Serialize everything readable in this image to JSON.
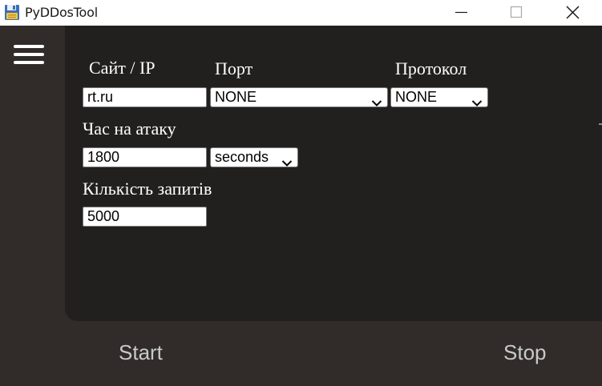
{
  "window": {
    "title": "PyDDosTool",
    "app_icon": "floppy-disk-icon",
    "controls": [
      "minimize-icon",
      "maximize-icon",
      "close-icon"
    ]
  },
  "sidebar": {
    "menu_icon": "hamburger-menu-icon"
  },
  "form": {
    "site_label": "Сайт / IP",
    "site_value": "rt.ru",
    "port_label": "Порт",
    "port_value": "NONE",
    "protocol_label": "Протокол",
    "protocol_value": "NONE",
    "time_label": "Час на атаку",
    "time_value": "1800",
    "time_unit": "seconds",
    "requests_label": "Кількість запитів",
    "requests_value": "5000"
  },
  "actions": {
    "start_label": "Start",
    "stop_label": "Stop"
  },
  "colors": {
    "panel_bg": "#221f1f",
    "frame_bg": "#312c2a",
    "text": "#ffffff",
    "button_text": "#c9c9c9"
  }
}
